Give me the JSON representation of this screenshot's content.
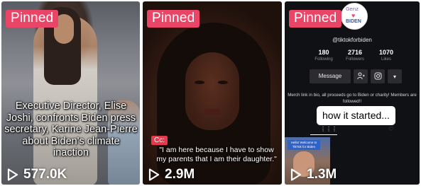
{
  "tiles": [
    {
      "badge": "Pinned",
      "caption": "Executive Director, Elise Joshi, confronts Biden press secretary, Karine Jean-Pierre about Biden's climate inaction",
      "views": "577.0K"
    },
    {
      "badge": "Pinned",
      "cc_label": "Cc:",
      "caption": "\"I am here because I have to show my parents that I am their daughter.\"",
      "views": "2.9M"
    },
    {
      "badge": "Pinned",
      "views": "1.3M",
      "profile": {
        "avatar_text_top": "Genz",
        "avatar_text_bottom": "BIDEN",
        "handle": "@tiktokforbiden",
        "stats": [
          {
            "value": "180",
            "label": "Following"
          },
          {
            "value": "2716",
            "label": "Followers"
          },
          {
            "value": "1070",
            "label": "Likes"
          }
        ],
        "message_button": "Message",
        "bio": "Merch link in bio, all proceeds go to Biden or charity! Members are followed!!",
        "caption": "how it started...",
        "thumb_label": "Hello! Welcome to TikTok for Biden"
      }
    }
  ],
  "colors": {
    "pinned_badge": "#ea4566",
    "cc_badge": "#e5394e",
    "text_light": "#ffffff"
  },
  "icons": {
    "play": "play-icon",
    "add_friend": "add-user-icon",
    "instagram": "instagram-icon",
    "more": "caret-down-icon",
    "grid_tab": "grid-icon",
    "liked_tab": "heart-icon"
  }
}
